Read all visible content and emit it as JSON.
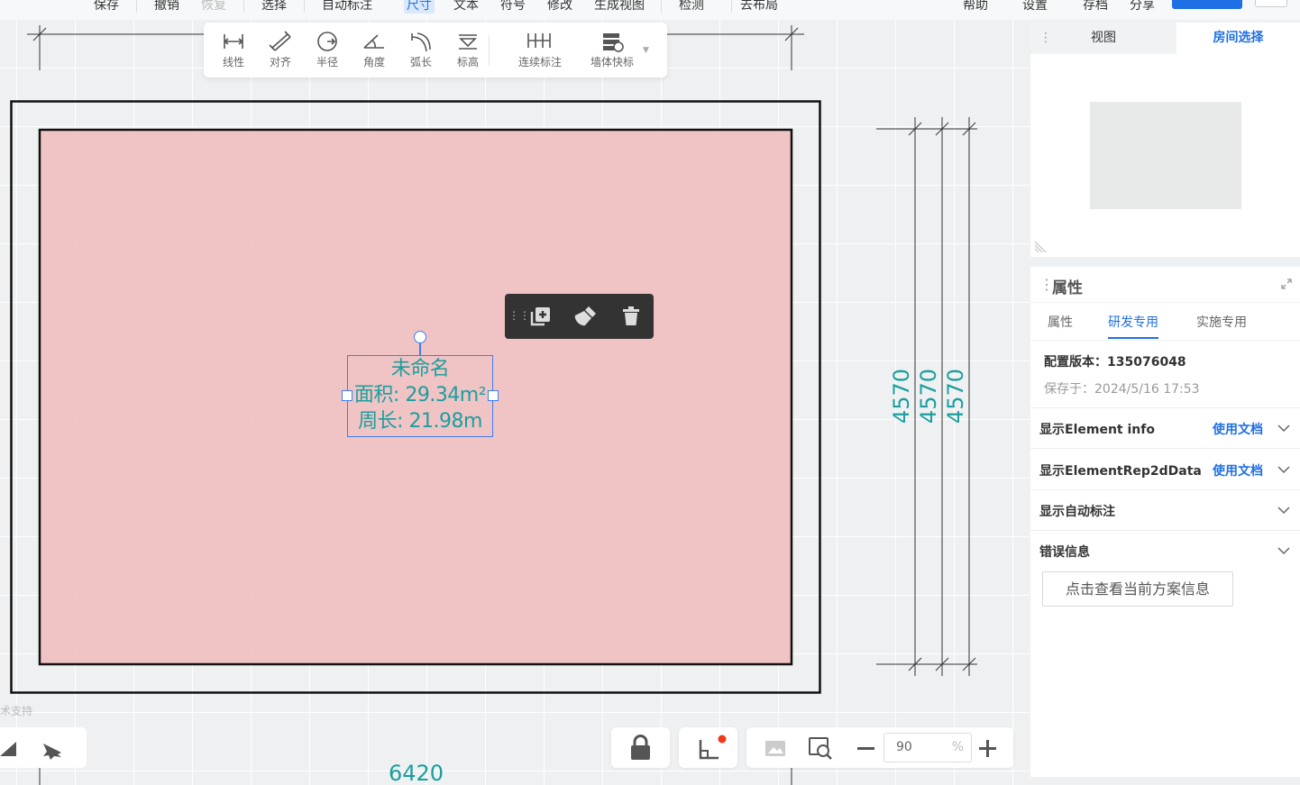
{
  "menu": {
    "items": [
      "保存",
      "撤销",
      "恢复",
      "选择",
      "自动标注",
      "尺寸",
      "文本",
      "符号",
      "修改",
      "生成视图",
      "检测",
      "去布局"
    ],
    "right_items": [
      "帮助",
      "设置",
      "存档",
      "分享"
    ]
  },
  "dim_toolbar": {
    "tools": [
      {
        "label": "线性",
        "icon": "linear-dimension-icon"
      },
      {
        "label": "对齐",
        "icon": "aligned-dimension-icon"
      },
      {
        "label": "半径",
        "icon": "radius-icon"
      },
      {
        "label": "角度",
        "icon": "angle-icon"
      },
      {
        "label": "弧长",
        "icon": "arc-length-icon"
      },
      {
        "label": "标高",
        "icon": "elevation-icon"
      },
      {
        "label": "连续标注",
        "icon": "continuous-dimension-icon"
      },
      {
        "label": "墙体快标",
        "icon": "wall-quick-dimension-icon"
      }
    ]
  },
  "room": {
    "name": "未命名",
    "area": "面积: 29.34m²",
    "perimeter": "周长: 21.98m",
    "fill_color": "#f0c0c1"
  },
  "dimensions": {
    "vertical": [
      "4570",
      "4570",
      "4570"
    ],
    "horizontal": "6420"
  },
  "canvas_footer": {
    "support_text": "术支持"
  },
  "zoom": {
    "value": "90",
    "unit": "%"
  },
  "view_panel": {
    "tabs": [
      "视图",
      "房间选择"
    ],
    "active_tab": "房间选择"
  },
  "properties_panel": {
    "title": "属性",
    "tabs": [
      "属性",
      "研发专用",
      "实施专用"
    ],
    "active_tab": "研发专用",
    "config_version": "配置版本：135076048",
    "saved_at": "保存于：2024/5/16 17:53",
    "sections": [
      {
        "label": "显示Element info",
        "link": "使用文档"
      },
      {
        "label": "显示ElementRep2dData",
        "link": "使用文档"
      },
      {
        "label": "显示自动标注",
        "link": ""
      },
      {
        "label": "错误信息",
        "link": ""
      }
    ],
    "info_button": "点击查看当前方案信息"
  },
  "colors": {
    "accent": "#1f6fe5",
    "dimension": "#1c9e9e",
    "selection": "#3d7df0"
  }
}
